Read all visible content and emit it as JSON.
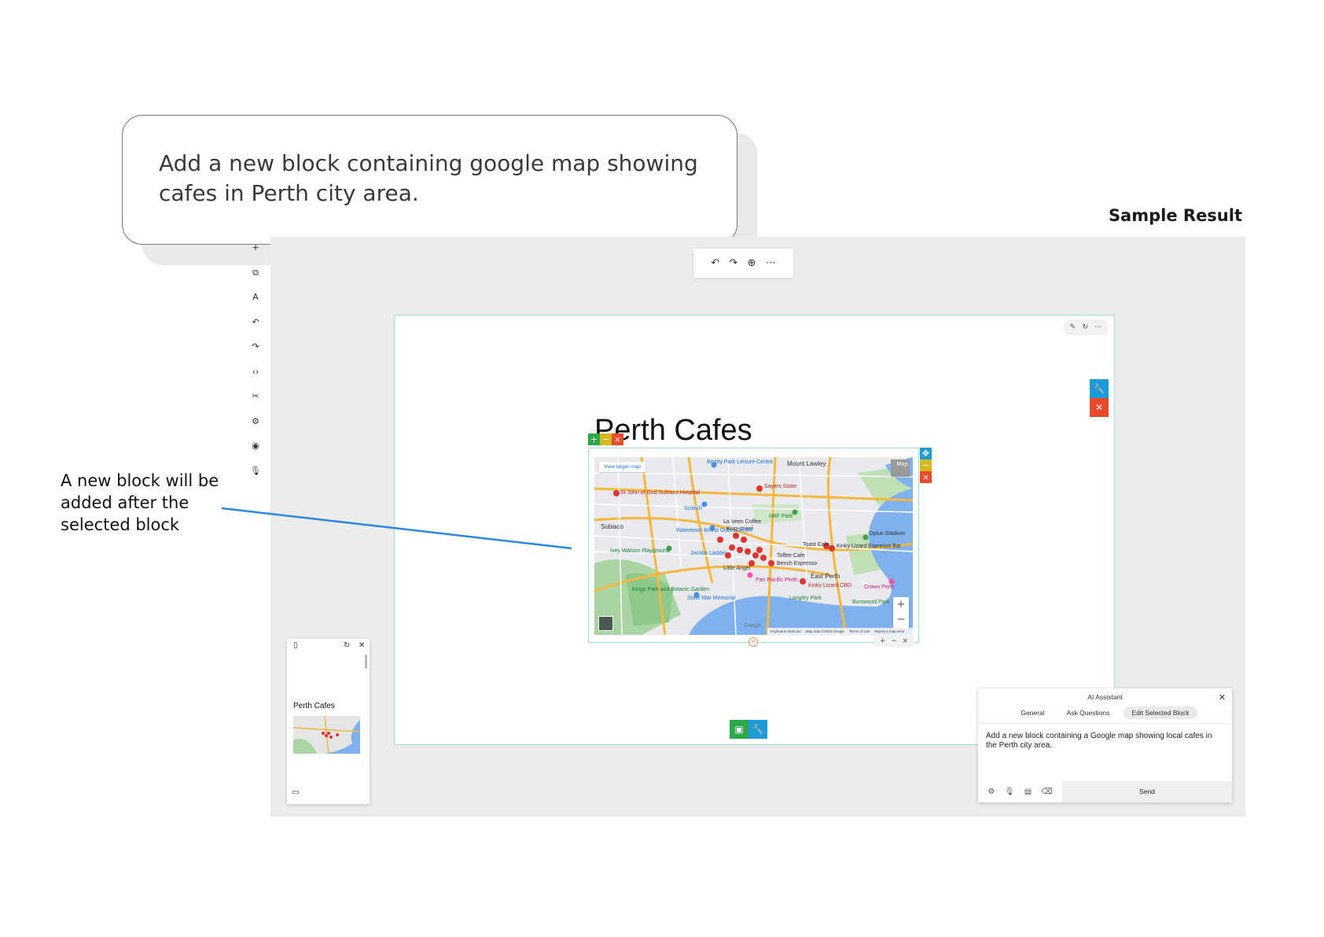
{
  "instruction": {
    "text": "Add a new block containing google map showing cafes in Perth city area."
  },
  "sample_result_label": "Sample Result",
  "annotation": {
    "text": "A new block will be added after the selected block"
  },
  "side_toolbar": {
    "icons": [
      "plus-icon",
      "copy-icon",
      "text-style-icon",
      "undo-icon",
      "redo-icon",
      "code-icon",
      "tools-icon",
      "settings-icon",
      "preview-icon",
      "microphone-icon"
    ]
  },
  "top_toolbar": {
    "icons": [
      "undo-icon",
      "redo-icon",
      "zoom-icon",
      "more-icon"
    ]
  },
  "page": {
    "title": "Perth Cafes"
  },
  "map": {
    "view_larger": "View larger map",
    "labels": {
      "beatty_park": "Beatty Park Leisure Centre",
      "mount_lawley": "Mount Lawley",
      "st_john": "St John of God Subiaco Hospital",
      "sayers": "Sayers Sister",
      "subiaco": "Subiaco",
      "scitech": "Scitech",
      "hbf_park": "HBF Park",
      "la_veen": "La Veen Coffee",
      "king_street": "King street",
      "watertown": "Watertown Brand Outlet Centre",
      "optus": "Optus Stadium",
      "toast": "Toast Cafe",
      "kinky_lizard": "Kinky Lizard Espresso Bar",
      "ivey": "Ivey Watson Playground",
      "jacobs": "Jacobs Ladder",
      "little_angel": "Little Angel",
      "toffee": "Toffee Cafe",
      "bench": "Bench Espresso",
      "pan_pacific": "Pan Pacific Perth",
      "kings_park": "Kings Park and Botanic Garden",
      "east_perth": "East Perth",
      "state_war": "State War Memorial",
      "kinky_cbd": "Kinky Lizard CBD",
      "langley": "Langley Park",
      "crown": "Crown Perth",
      "burswood": "Burswood Park",
      "map_type": "Map"
    },
    "google": "Google",
    "footer": [
      "Keyboard shortcuts",
      "Map data ©2023 Google",
      "Terms of Use",
      "Report a map error"
    ]
  },
  "preview": {
    "title": "Perth Cafes"
  },
  "ai_assistant": {
    "title": "AI Assistant",
    "tabs": [
      "General",
      "Ask Questions",
      "Edit Selected Block"
    ],
    "active_tab": "Edit Selected Block",
    "prompt": "Add a new block containing a Google map showing local cafes in the Perth city area.",
    "send": "Send",
    "icons": [
      "settings-icon",
      "mic-off-icon",
      "chat-icon",
      "eraser-icon"
    ]
  },
  "colors": {
    "accent_green": "#2ca84a",
    "accent_yellow": "#d8b820",
    "accent_red": "#ea4a2c",
    "accent_blue": "#1e9ad6",
    "selection_outline": "#9be5c8",
    "annotation_line": "#2b86e8"
  }
}
